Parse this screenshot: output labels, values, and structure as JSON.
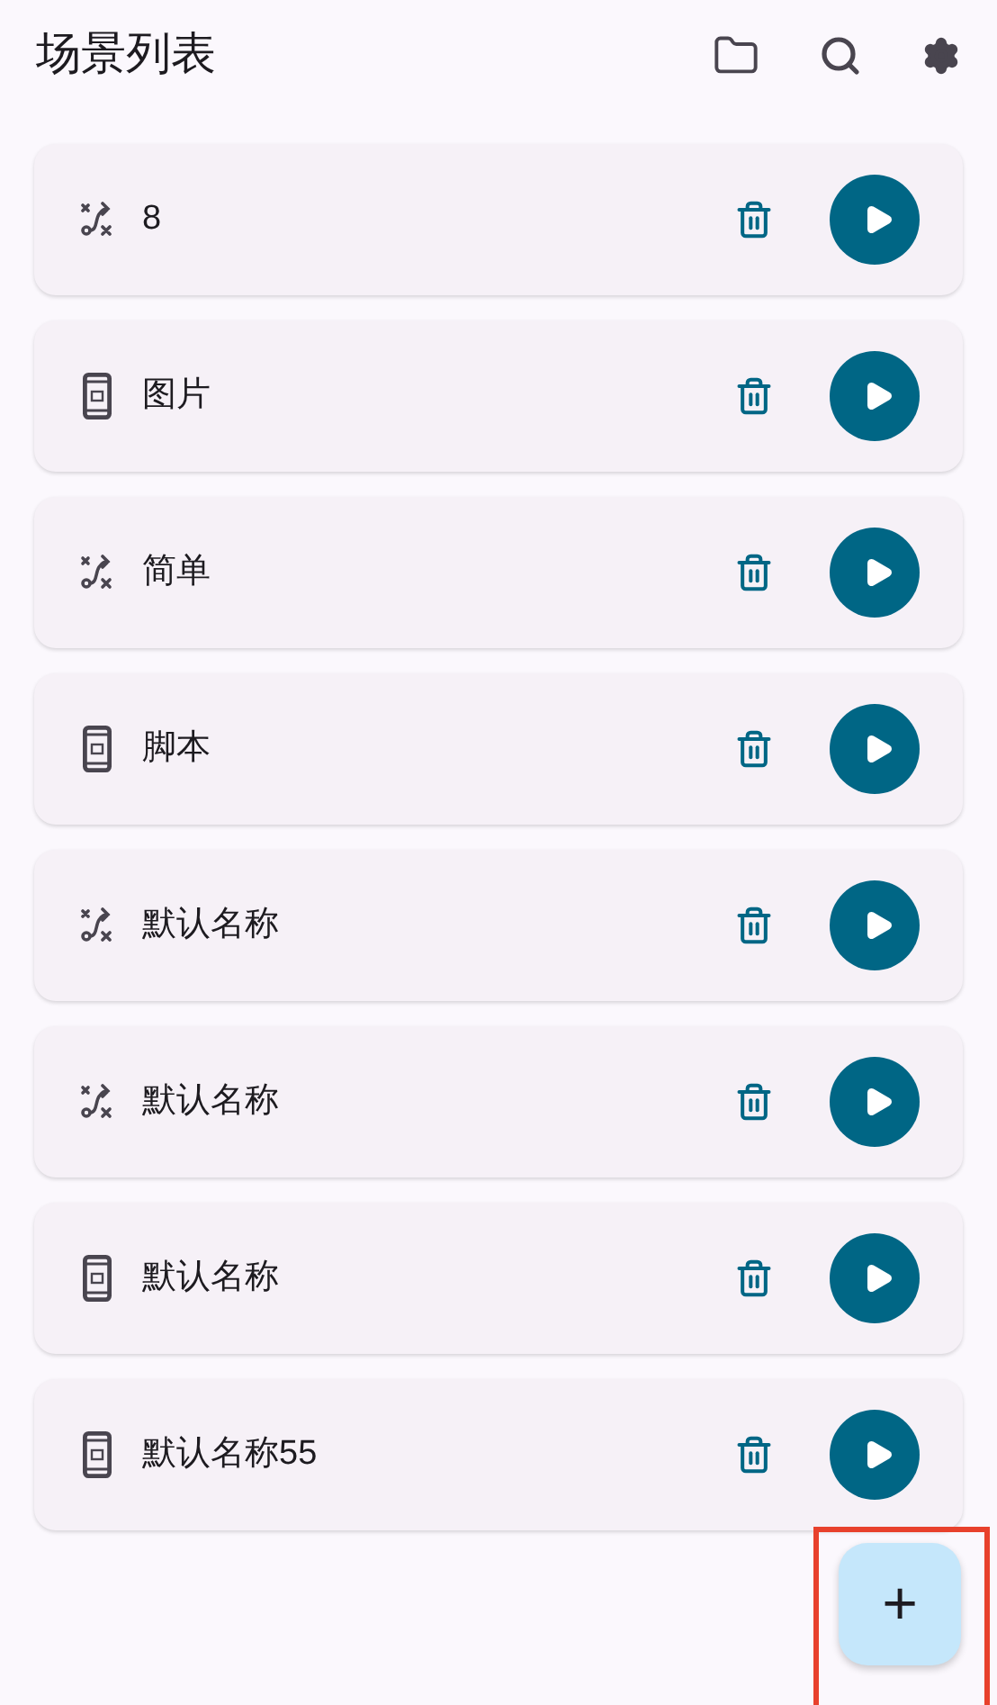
{
  "header": {
    "title": "场景列表"
  },
  "scenes": [
    {
      "name": "8",
      "kind": "route"
    },
    {
      "name": "图片",
      "kind": "phone"
    },
    {
      "name": "简单",
      "kind": "route"
    },
    {
      "name": "脚本",
      "kind": "phone"
    },
    {
      "name": "默认名称",
      "kind": "route"
    },
    {
      "name": "默认名称",
      "kind": "route"
    },
    {
      "name": "默认名称",
      "kind": "phone"
    },
    {
      "name": "默认名称55",
      "kind": "phone"
    }
  ],
  "fab": {
    "label": "+",
    "highlighted": true
  }
}
